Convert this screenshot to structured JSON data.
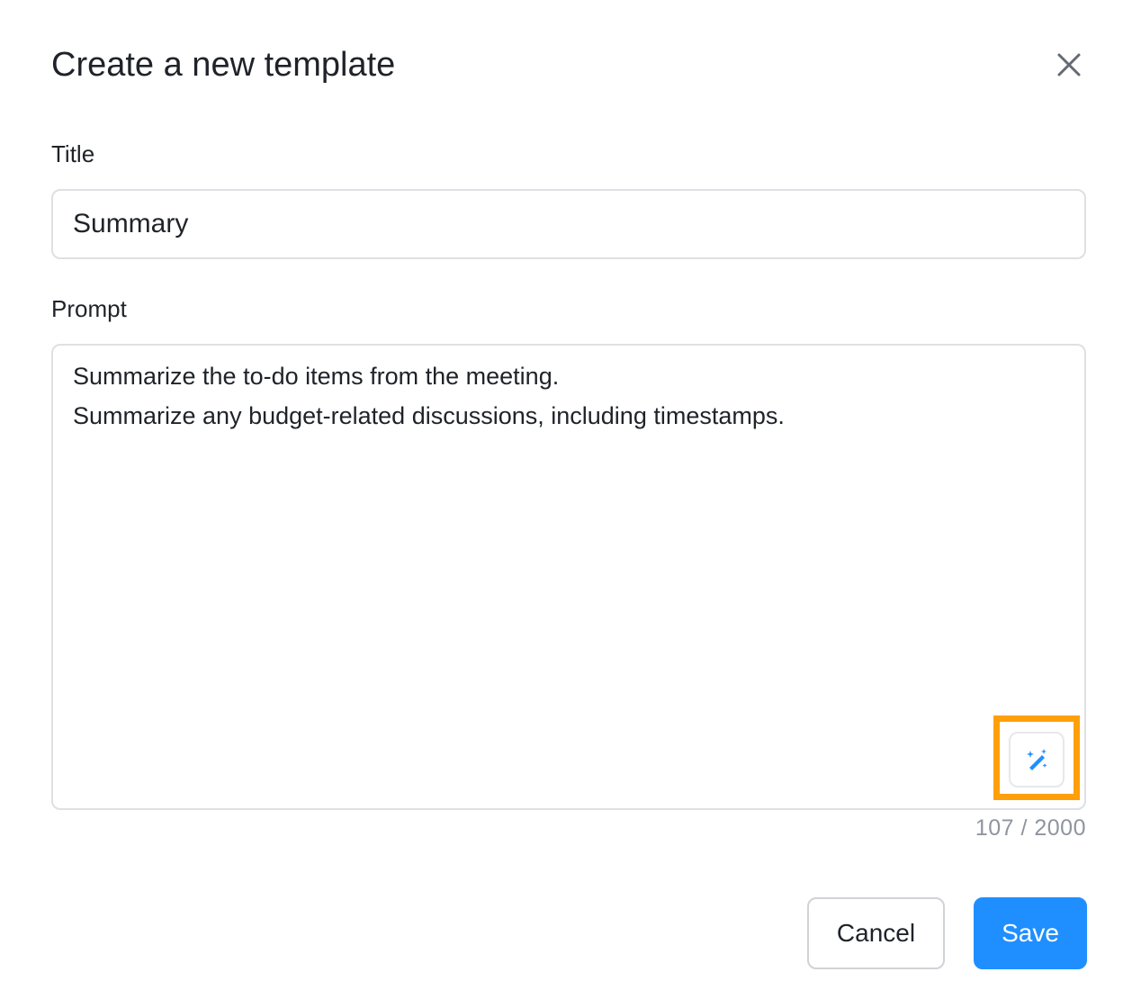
{
  "dialog": {
    "title": "Create a new template",
    "close_icon": "close-icon"
  },
  "form": {
    "title_label": "Title",
    "title_value": "Summary",
    "prompt_label": "Prompt",
    "prompt_lines": [
      "Summarize the to-do items from the meeting.",
      "Summarize any budget-related discussions, including timestamps."
    ],
    "char_count": "107 / 2000",
    "magic_icon": "magic-wand-icon"
  },
  "actions": {
    "cancel_label": "Cancel",
    "save_label": "Save"
  },
  "colors": {
    "accent": "#1f8fff",
    "highlight": "#ff9f0a",
    "border": "#dee0e3",
    "muted_text": "#8f959e"
  }
}
